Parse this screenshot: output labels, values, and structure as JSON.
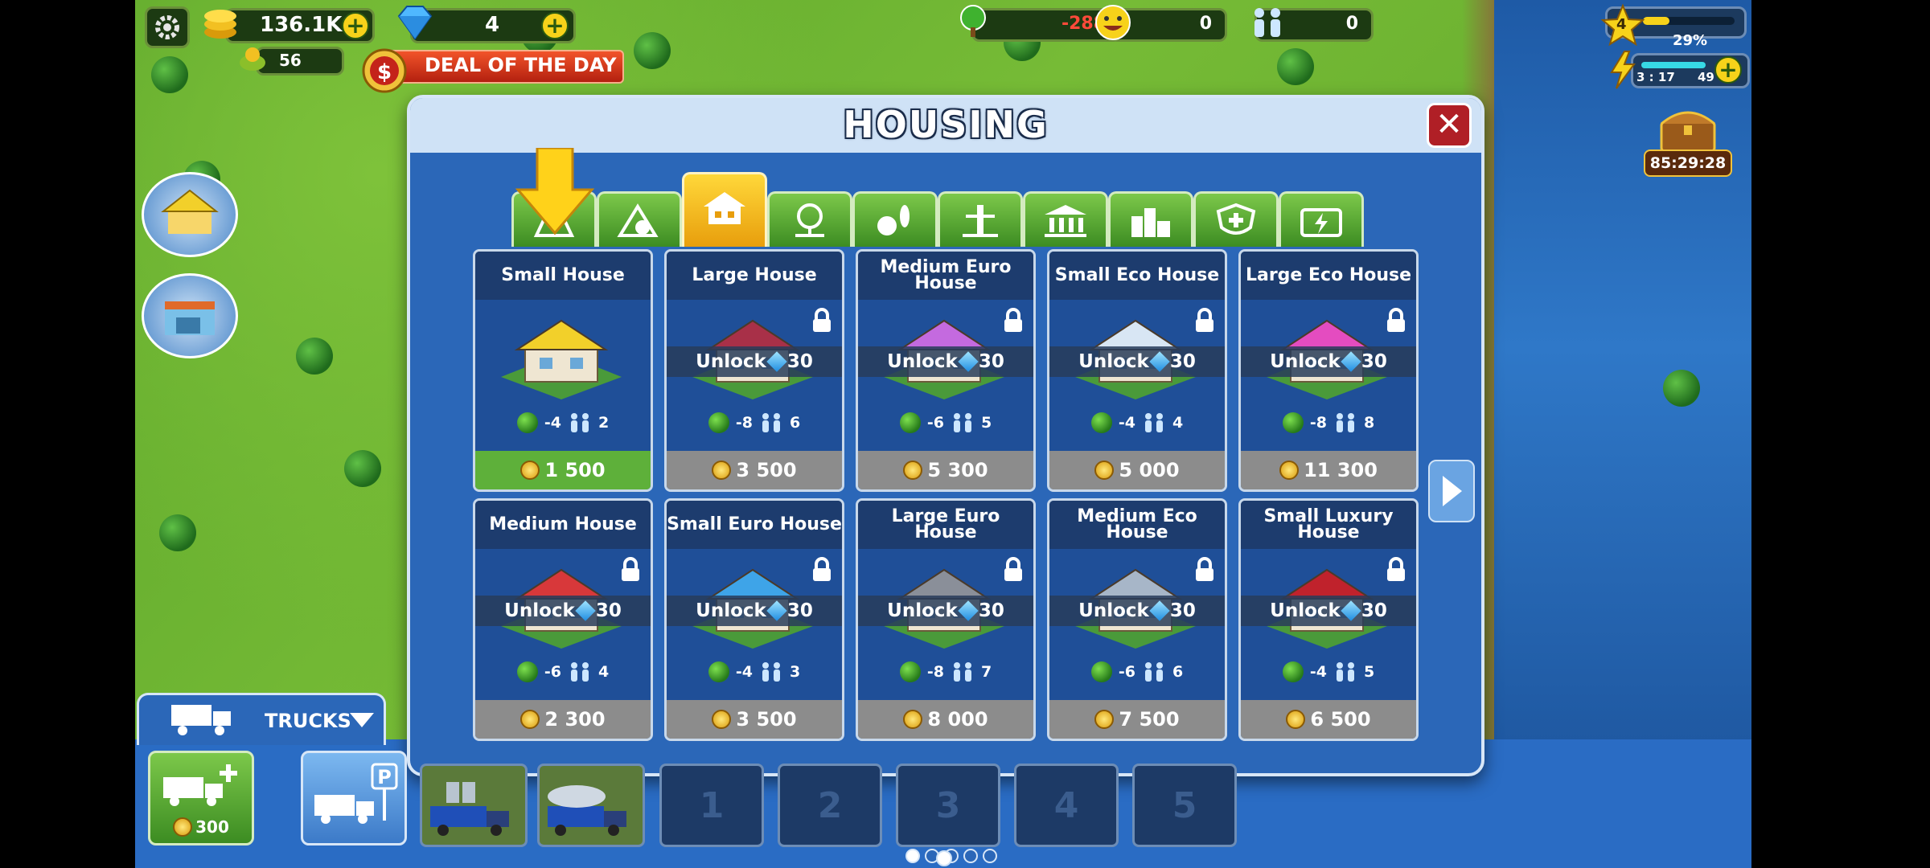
{
  "hud": {
    "coins": "136.1K",
    "gems": "4",
    "small_coins": "56",
    "deal_label": "DEAL OF THE DAY",
    "ecology": "-288",
    "happiness": "0",
    "population": "0",
    "level": "4",
    "xp_percent": "29%",
    "energy_timer": "3 : 17",
    "energy_value": "49",
    "chest_timer": "85:29:28"
  },
  "dialog": {
    "title": "HOUSING",
    "tabs": [
      {
        "name": "tab-roads",
        "icon": "road-icon"
      },
      {
        "name": "tab-services",
        "icon": "services-icon"
      },
      {
        "name": "tab-housing",
        "icon": "house-icon"
      },
      {
        "name": "tab-parks",
        "icon": "park-icon"
      },
      {
        "name": "tab-entertainment",
        "icon": "bowling-icon"
      },
      {
        "name": "tab-industry",
        "icon": "rocket-icon"
      },
      {
        "name": "tab-government",
        "icon": "bank-icon"
      },
      {
        "name": "tab-factories",
        "icon": "factory-icon"
      },
      {
        "name": "tab-health",
        "icon": "shield-icon"
      },
      {
        "name": "tab-energy",
        "icon": "battery-icon"
      }
    ],
    "active_tab": "tab-housing",
    "unlock_label": "Unlock",
    "unlock_cost": "30",
    "pages": 5,
    "current_page": 1
  },
  "cards": [
    {
      "title": "Small House",
      "eco": "-4",
      "people": "2",
      "price": "1 500",
      "locked": false,
      "color": "#f2d02a"
    },
    {
      "title": "Large House",
      "eco": "-8",
      "people": "6",
      "price": "3 500",
      "locked": true,
      "color": "#a83048"
    },
    {
      "title": "Medium Euro House",
      "eco": "-6",
      "people": "5",
      "price": "5 300",
      "locked": true,
      "color": "#c46adf"
    },
    {
      "title": "Small Eco House",
      "eco": "-4",
      "people": "4",
      "price": "5 000",
      "locked": true,
      "color": "#d8e6f4"
    },
    {
      "title": "Large Eco House",
      "eco": "-8",
      "people": "8",
      "price": "11 300",
      "locked": true,
      "color": "#e44cc0"
    },
    {
      "title": "Medium House",
      "eco": "-6",
      "people": "4",
      "price": "2 300",
      "locked": true,
      "color": "#d8383a"
    },
    {
      "title": "Small Euro House",
      "eco": "-4",
      "people": "3",
      "price": "3 500",
      "locked": true,
      "color": "#3ea4e8"
    },
    {
      "title": "Large Euro House",
      "eco": "-8",
      "people": "7",
      "price": "8 000",
      "locked": true,
      "color": "#8a8f99"
    },
    {
      "title": "Medium Eco House",
      "eco": "-6",
      "people": "6",
      "price": "7 500",
      "locked": true,
      "color": "#a7b6c8"
    },
    {
      "title": "Small Luxury House",
      "eco": "-4",
      "people": "5",
      "price": "6 500",
      "locked": true,
      "color": "#c0222c"
    }
  ],
  "trucks": {
    "label": "TRUCKS",
    "buy_price": "300",
    "slots": [
      "1",
      "2",
      "3",
      "4",
      "5"
    ]
  }
}
